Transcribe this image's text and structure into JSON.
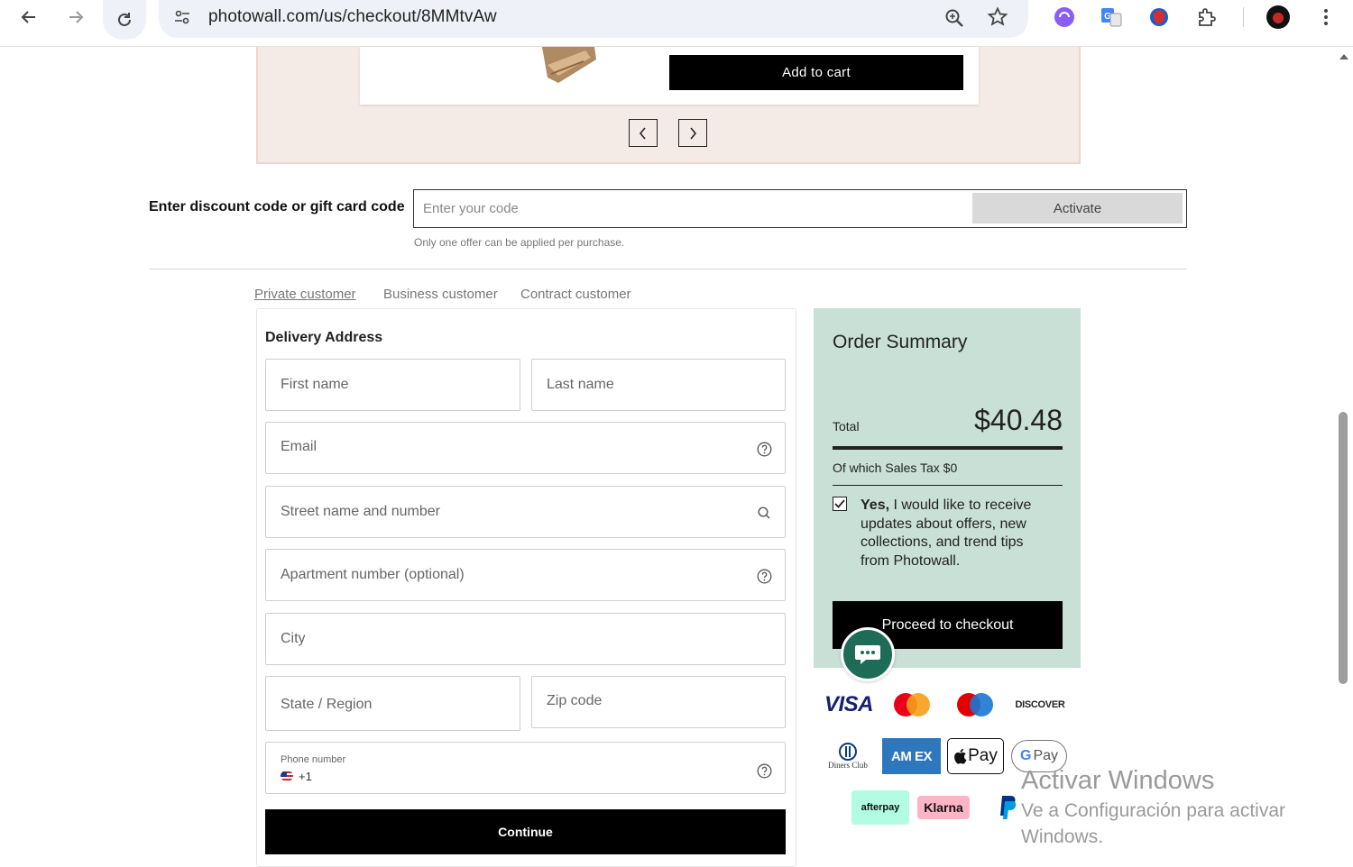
{
  "browser": {
    "url": "photowall.com/us/checkout/8MMtvAw"
  },
  "carousel": {
    "add_to_cart": "Add to cart"
  },
  "discount": {
    "label": "Enter discount code or gift card code",
    "placeholder": "Enter your code",
    "activate": "Activate",
    "note": "Only one offer can be applied per purchase."
  },
  "customer_tabs": [
    "Private customer",
    "Business customer",
    "Contract customer"
  ],
  "form": {
    "title": "Delivery Address",
    "first_name": "First name",
    "last_name": "Last name",
    "email": "Email",
    "street": "Street name and number",
    "apartment": "Apartment number (optional)",
    "city": "City",
    "state": "State / Region",
    "zip": "Zip code",
    "phone_label": "Phone number",
    "phone_code": "+1",
    "continue": "Continue"
  },
  "summary": {
    "title": "Order Summary",
    "total_label": "Total",
    "total_amount": "$40.48",
    "tax": "Of which Sales Tax $0",
    "consent_yes": "Yes,",
    "consent_rest": " I would like to receive updates about offers, new collections, and trend tips from Photowall.",
    "consent_checked": true,
    "proceed": "Proceed to checkout"
  },
  "payments": {
    "visa": "VISA",
    "discover": "DISCOVER",
    "diners": "Diners Club",
    "amex": "AM EX",
    "apple_pay": "Pay",
    "google_pay": "Pay",
    "afterpay": "afterpay",
    "klarna": "Klarna"
  },
  "windows_watermark": {
    "title": "Activar Windows",
    "line1": "Ve a Configuración para activar",
    "line2": "Windows."
  },
  "colors": {
    "summary_bg": "#c9e0d6",
    "carousel_bg": "#f5ebe6",
    "chat_bubble": "#1e6b58"
  }
}
